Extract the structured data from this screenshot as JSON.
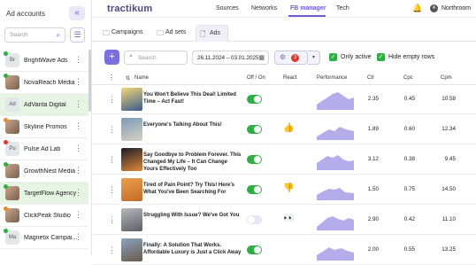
{
  "sidebar": {
    "title": "Ad accounts",
    "collapse_icon": "«",
    "search_placeholder": "Search",
    "accounts": [
      {
        "initials": "Br",
        "name": "BrightWave Ads",
        "dot": "#2fae43",
        "image": false,
        "highlight": false
      },
      {
        "initials": "",
        "name": "NovaReach Media",
        "dot": "#2fae43",
        "image": true,
        "highlight": false
      },
      {
        "initials": "Ad",
        "name": "AdVanta Digital",
        "dot": "",
        "image": false,
        "highlight": true
      },
      {
        "initials": "",
        "name": "Skyline Promos",
        "dot": "#e98a2b",
        "image": true,
        "highlight": false
      },
      {
        "initials": "Pu",
        "name": "Pulse Ad Lab",
        "dot": "#e0392b",
        "image": false,
        "highlight": false
      },
      {
        "initials": "",
        "name": "GrowthNest Media",
        "dot": "#2fae43",
        "image": true,
        "highlight": false
      },
      {
        "initials": "",
        "name": "TargetFlow Agency",
        "dot": "#2fae43",
        "image": true,
        "highlight": true
      },
      {
        "initials": "",
        "name": "ClickPeak Studio",
        "dot": "#e98a2b",
        "image": true,
        "highlight": false
      },
      {
        "initials": "Ma",
        "name": "Magnetix Campai...",
        "dot": "#2fae43",
        "image": false,
        "highlight": false
      }
    ]
  },
  "topbar": {
    "logo": "tractikum",
    "nav": [
      "Sources",
      "Networks",
      "FB manager",
      "Tech"
    ],
    "active_nav": "FB manager",
    "user_initial": "A",
    "user_name": "Northroom"
  },
  "tabs": [
    {
      "label": "Campaigns",
      "icon": "folder-icon"
    },
    {
      "label": "Ad sets",
      "icon": "folder-grid-icon"
    },
    {
      "label": "Ads",
      "icon": "document-icon"
    }
  ],
  "active_tab": "Ads",
  "filters": {
    "search_placeholder": "Search",
    "date_range": "26.11.2024 – 03.01.2025",
    "config_badge": "3",
    "only_active_label": "Only active",
    "hide_empty_label": "Hide empty rows",
    "only_active_checked": true,
    "hide_empty_checked": true
  },
  "table": {
    "headers": {
      "name": "Name",
      "status": "Off / On",
      "react": "React",
      "performance": "Performance",
      "ctr": "Ctr",
      "cpc": "Cpc",
      "cpm": "Cpm"
    },
    "rows": [
      {
        "name": "You Won't Believe This Deal! Limited Time – Act Fast!",
        "on": true,
        "react": "",
        "ctr": "2.35",
        "cpc": "0.45",
        "cpm": "10.58",
        "thumb": [
          "#f3d77a",
          "#3a5a8a"
        ]
      },
      {
        "name": "Everyone's Talking About This!",
        "on": true,
        "react": "👍",
        "ctr": "1.89",
        "cpc": "0.60",
        "cpm": "12.34",
        "thumb": [
          "#7a9ab8",
          "#d9d2c2"
        ]
      },
      {
        "name": "Say Goodbye to Problem Forever. This Changed My Life – It Can Change Yours Effectively Too",
        "on": true,
        "react": "",
        "ctr": "3.12",
        "cpc": "0.38",
        "cpm": "9.45",
        "thumb": [
          "#1a1a24",
          "#e08a3a"
        ]
      },
      {
        "name": "Tired of Pain Point? Try This! Here's What You've Been Searching For",
        "on": true,
        "react": "👎",
        "ctr": "1.50",
        "cpc": "0.75",
        "cpm": "14.50",
        "thumb": [
          "#e9a04a",
          "#c56a2a"
        ]
      },
      {
        "name": "Struggling With Issue? We've Got You",
        "on": false,
        "react": "👀",
        "ctr": "2.90",
        "cpc": "0.42",
        "cpm": "11.10",
        "thumb": [
          "#b7b9bd",
          "#5c5f66"
        ]
      },
      {
        "name": "Finally: A Solution That Works. Affordable Luxury is Just a Click Away",
        "on": true,
        "react": "",
        "ctr": "2.00",
        "cpc": "0.55",
        "cpm": "13.25",
        "thumb": [
          "#8aa3c0",
          "#6a5a4a"
        ]
      }
    ]
  }
}
